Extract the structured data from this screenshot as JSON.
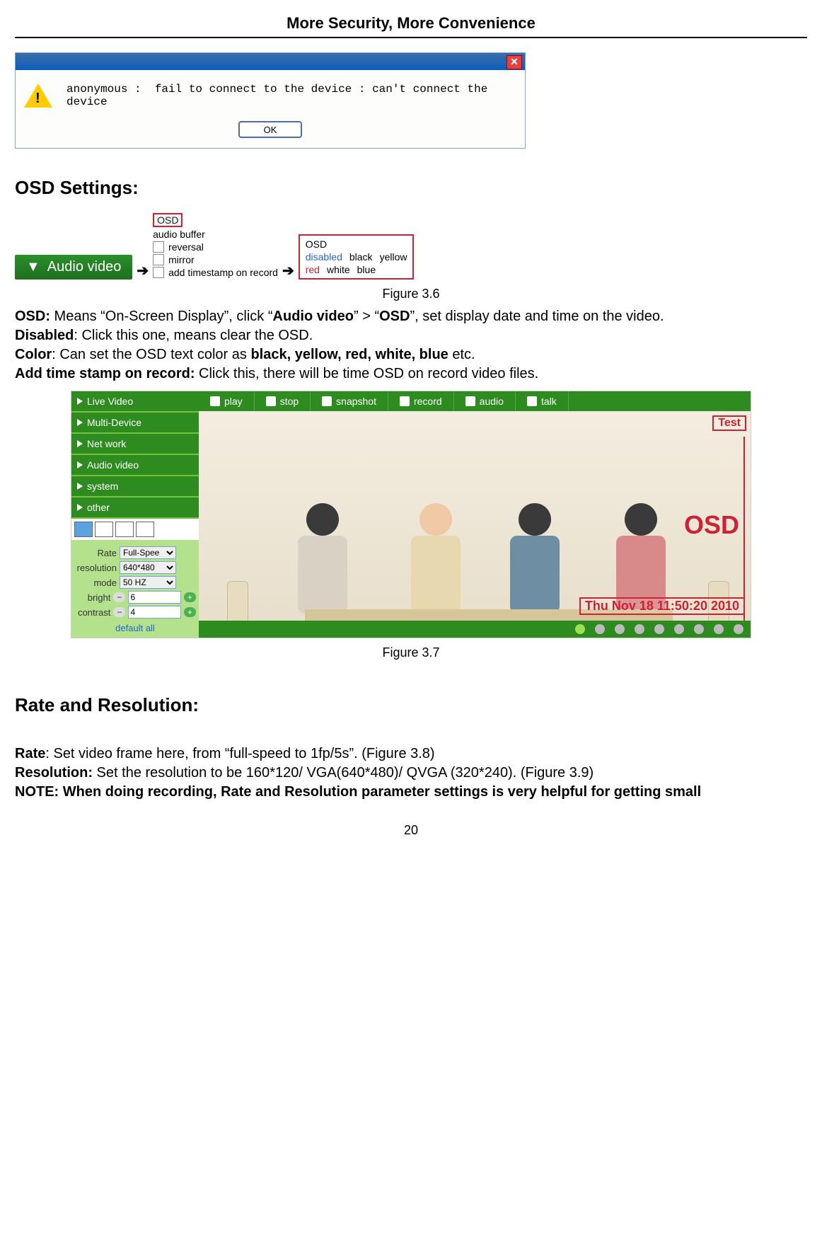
{
  "header": "More Security, More Convenience",
  "dialog": {
    "message": "anonymous :  fail to connect to the device : can't connect the device",
    "ok_label": "OK"
  },
  "section1_heading": "OSD Settings:",
  "audio_video_btn": "Audio video",
  "osd_panel": {
    "osd_label": "OSD",
    "item1": "audio buffer",
    "item2": "reversal",
    "item3": "mirror",
    "item4": "add timestamp on record"
  },
  "osd_colors": {
    "title": "OSD",
    "row1": [
      "disabled",
      "black",
      "yellow"
    ],
    "row2": [
      "red",
      "white",
      "blue"
    ]
  },
  "figure36_caption": "Figure 3.6",
  "para": {
    "osd_label": "OSD:",
    "osd_text1": " Means “On-Screen Display”, click “",
    "osd_bold1": "Audio video",
    "osd_text2": "” > “",
    "osd_bold2": "OSD",
    "osd_text3": "”, set display date and time on the video.",
    "disabled_label": "Disabled",
    "disabled_text": ": Click this one, means clear the OSD.",
    "color_label": "Color",
    "color_text1": ": Can set the OSD text color as ",
    "color_bold": "black, yellow, red, white, blue",
    "color_text2": " etc.",
    "addts_label": "Add time stamp on record:",
    "addts_text": " Click this, there will be time OSD on record video files."
  },
  "ui": {
    "sidebar_items": [
      "Live Video",
      "Multi-Device",
      "Net work",
      "Audio video",
      "system",
      "other"
    ],
    "topbar_items": [
      "play",
      "stop",
      "snapshot",
      "record",
      "audio",
      "talk"
    ],
    "controls": {
      "rate_label": "Rate",
      "rate_value": "Full-Spee",
      "resolution_label": "resolution",
      "resolution_value": "640*480",
      "mode_label": "mode",
      "mode_value": "50 HZ",
      "bright_label": "bright",
      "bright_value": "6",
      "contrast_label": "contrast",
      "contrast_value": "4",
      "defaultall": "default all"
    },
    "overlay_test": "Test",
    "overlay_osd": "OSD",
    "timestamp": "Thu Nov 18 11:50:20 2010"
  },
  "figure37_caption": "Figure 3.7",
  "section2_heading": "Rate and Resolution:",
  "para2": {
    "rate_label": "Rate",
    "rate_text": ": Set video frame here, from “full-speed to 1fp/5s”. (Figure 3.8)",
    "res_label": "Resolution:",
    "res_text": " Set the resolution to be 160*120/ VGA(640*480)/ QVGA (320*240). (Figure 3.9)",
    "note": "NOTE: When doing recording, Rate and Resolution parameter settings is very helpful for getting small"
  },
  "page_number": "20"
}
